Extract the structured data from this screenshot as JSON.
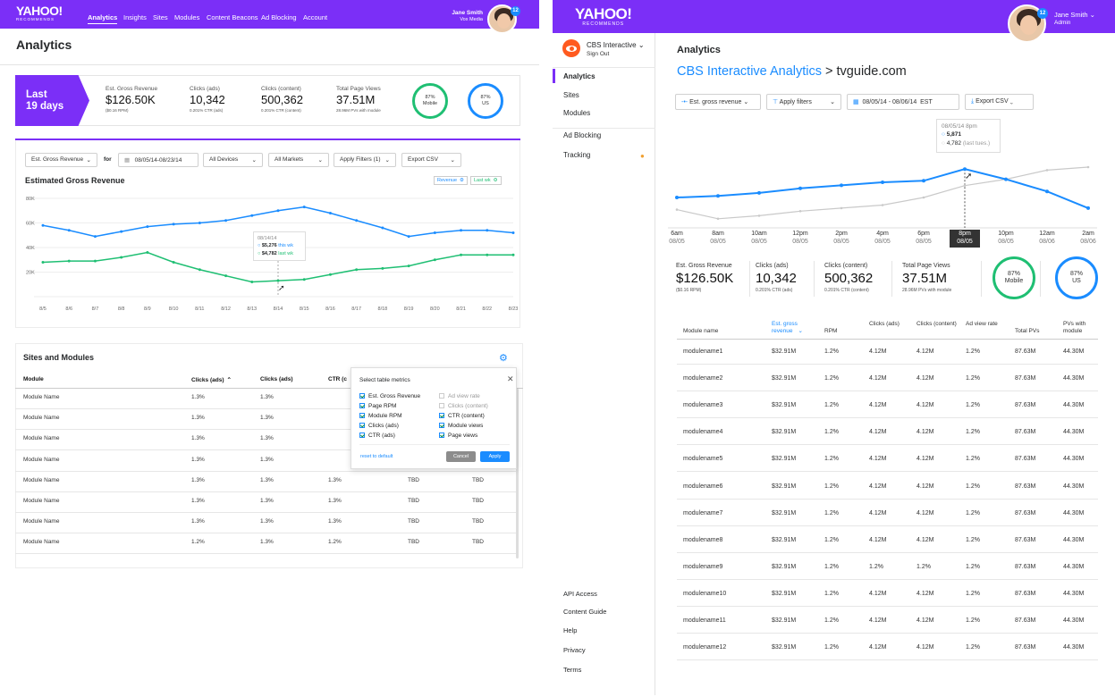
{
  "left": {
    "logo": {
      "name": "YAHOO!",
      "sub": "RECOMMENDS"
    },
    "nav": [
      "Analytics",
      "Insights",
      "Sites",
      "Modules",
      "Content Beacons",
      "Ad Blocking",
      "Account"
    ],
    "user": {
      "name": "Jane Smith",
      "org": "Vox Media",
      "badge": "12"
    },
    "page_title": "Analytics",
    "period": {
      "line1": "Last",
      "line2": "19 days"
    },
    "kpis": [
      {
        "label": "Est. Gross Revenue",
        "value": "$126.50K",
        "sub": "($0.16 RPM)"
      },
      {
        "label": "Clicks (ads)",
        "value": "10,342",
        "sub": "0.201% CTR (ads)"
      },
      {
        "label": "Clicks (content)",
        "value": "500,362",
        "sub": "0.201% CTR (content)"
      },
      {
        "label": "Total Page Views",
        "value": "37.51M",
        "sub": "28.96M PVs with module"
      }
    ],
    "rings": [
      {
        "pct": "87%",
        "label": "Mobile",
        "color": "#1fbf73"
      },
      {
        "pct": "87%",
        "label": "US",
        "color": "#1a8cff"
      }
    ],
    "filters": {
      "metric": "Est. Gross Revenue",
      "for": "for",
      "date": "08/05/14-08/23/14",
      "devices": "All Devices",
      "markets": "All Markets",
      "apply": "Apply Filters (1)",
      "export": "Export CSV"
    },
    "chart_title": "Estimated Gross Revenue",
    "legend": [
      {
        "label": "Revenue",
        "color": "#1a8cff"
      },
      {
        "label": "Last wk",
        "color": "#1fbf73"
      }
    ],
    "tooltip": {
      "date": "08/14/14",
      "v1": "$5,276",
      "l1": "this wk",
      "v2": "$4,782",
      "l2": "last wk"
    },
    "table_title": "Sites and Modules",
    "table_headers": [
      "Module",
      "Clicks (ads)",
      "Clicks (ads)",
      "CTR (c"
    ],
    "rows": [
      [
        "Module Name",
        "1.3%",
        "1.3%",
        "",
        "",
        ""
      ],
      [
        "Module Name",
        "1.3%",
        "1.3%",
        "",
        "",
        ""
      ],
      [
        "Module Name",
        "1.3%",
        "1.3%",
        "",
        "",
        ""
      ],
      [
        "Module Name",
        "1.3%",
        "1.3%",
        "",
        "",
        ""
      ],
      [
        "Module Name",
        "1.3%",
        "1.3%",
        "1.3%",
        "TBD",
        "TBD"
      ],
      [
        "Module Name",
        "1.3%",
        "1.3%",
        "1.3%",
        "TBD",
        "TBD"
      ],
      [
        "Module Name",
        "1.3%",
        "1.3%",
        "1.3%",
        "TBD",
        "TBD"
      ],
      [
        "Module Name",
        "1.2%",
        "1.3%",
        "1.2%",
        "TBD",
        "TBD"
      ]
    ],
    "popup": {
      "title": "Select table metrics",
      "col1": [
        {
          "label": "Est. Gross Revenue",
          "on": true
        },
        {
          "label": "Page RPM",
          "on": true
        },
        {
          "label": "Module RPM",
          "on": true
        },
        {
          "label": "Clicks (ads)",
          "on": true
        },
        {
          "label": "CTR (ads)",
          "on": true
        }
      ],
      "col2": [
        {
          "label": "Ad view rate",
          "on": false
        },
        {
          "label": "Clicks (content)",
          "on": false
        },
        {
          "label": "CTR (content)",
          "on": true
        },
        {
          "label": "Module views",
          "on": true
        },
        {
          "label": "Page views",
          "on": true
        }
      ],
      "reset": "reset to default",
      "cancel": "Cancel",
      "apply": "Apply"
    }
  },
  "chart_data": [
    {
      "type": "line",
      "title": "Estimated Gross Revenue",
      "x": [
        "8/5",
        "8/6",
        "8/7",
        "8/8",
        "8/9",
        "8/10",
        "8/11",
        "8/12",
        "8/13",
        "8/14",
        "8/15",
        "8/16",
        "8/17",
        "8/18",
        "8/19",
        "8/20",
        "8/21",
        "8/22",
        "8/23"
      ],
      "yticks": [
        "80K",
        "60K",
        "40K",
        "20K"
      ],
      "ylim": [
        0,
        80000
      ],
      "series": [
        {
          "name": "Revenue",
          "color": "#1a8cff",
          "values": [
            58000,
            54000,
            49000,
            53000,
            57000,
            59000,
            60000,
            62000,
            66000,
            70000,
            73000,
            68000,
            62000,
            56000,
            49000,
            52000,
            54000,
            54000,
            52000
          ]
        },
        {
          "name": "Last wk",
          "color": "#1fbf73",
          "values": [
            28000,
            29000,
            29000,
            32000,
            36000,
            28000,
            22000,
            17000,
            12000,
            13000,
            14000,
            18000,
            22000,
            23000,
            25000,
            30000,
            34000,
            34000,
            34000
          ]
        }
      ]
    },
    {
      "type": "line",
      "x": [
        "6am 08/05",
        "8am 08/05",
        "10am 08/05",
        "12pm 08/05",
        "2pm 08/05",
        "4pm 08/05",
        "6pm 08/05",
        "8pm 08/05",
        "10pm 08/05",
        "12am 08/06",
        "2am 08/06"
      ],
      "series": [
        {
          "name": "",
          "color": "#1a8cff",
          "values": [
            4000,
            4100,
            4300,
            4600,
            4800,
            5000,
            5100,
            5871,
            5200,
            4400,
            3300
          ]
        },
        {
          "name": "(last tues.)",
          "color": "#c9c9c9",
          "values": [
            3200,
            2600,
            2800,
            3100,
            3300,
            3500,
            4000,
            4782,
            5200,
            5800,
            6000
          ]
        }
      ]
    }
  ],
  "right": {
    "logo": {
      "name": "YAHOO!",
      "sub": "RECOMMENDS"
    },
    "user": {
      "name": "Jane Smith",
      "role": "Admin",
      "badge": "12"
    },
    "account": {
      "name": "CBS Interactive",
      "signout": "Sign Out"
    },
    "side_nav": [
      "Analytics",
      "Sites",
      "Modules",
      "Ad Blocking",
      "Tracking"
    ],
    "side_bottom": [
      "API Access",
      "Content Guide",
      "Help",
      "Privacy",
      "Terms"
    ],
    "page_title": "Analytics",
    "breadcrumb": {
      "link": "CBS Interactive Analytics",
      "sep": ">",
      "current": "tvguide.com"
    },
    "filters": {
      "metric": "Est. gross revenue",
      "apply": "Apply filters",
      "date": "08/05/14 - 08/06/14",
      "tz": "EST",
      "export": "Export CSV"
    },
    "tooltip": {
      "date": "08/05/14 8pm",
      "v1": "5,871",
      "v2": "4,782",
      "l2": "(last tues.)"
    },
    "xticks": [
      [
        "6am",
        "08/05"
      ],
      [
        "8am",
        "08/05"
      ],
      [
        "10am",
        "08/05"
      ],
      [
        "12pm",
        "08/05"
      ],
      [
        "2pm",
        "08/05"
      ],
      [
        "4pm",
        "08/05"
      ],
      [
        "6pm",
        "08/05"
      ],
      [
        "8pm",
        "08/05"
      ],
      [
        "10pm",
        "08/05"
      ],
      [
        "12am",
        "08/06"
      ],
      [
        "2am",
        "08/06"
      ]
    ],
    "kpis": [
      {
        "label": "Est. Gross Revenue",
        "value": "$126.50K",
        "sub": "($0.16 RPM)"
      },
      {
        "label": "Clicks (ads)",
        "value": "10,342",
        "sub": "0.201% CTR (ads)"
      },
      {
        "label": "Clicks (content)",
        "value": "500,362",
        "sub": "0.201% CTR (content)"
      },
      {
        "label": "Total Page Views",
        "value": "37.51M",
        "sub": "28.96M PVs with module"
      }
    ],
    "rings": [
      {
        "pct": "87%",
        "label": "Mobile",
        "color": "#1fbf73"
      },
      {
        "pct": "87%",
        "label": "US",
        "color": "#1a8cff"
      }
    ],
    "table_headers": [
      "Module name",
      "Est. gross revenue",
      "RPM",
      "Clicks (ads)",
      "Clicks (content)",
      "Ad view rate",
      "Total PVs",
      "PVs with module"
    ],
    "rows": [
      [
        "modulename1",
        "$32.91M",
        "1.2%",
        "4.12M",
        "4.12M",
        "1.2%",
        "87.63M",
        "44.30M"
      ],
      [
        "modulename2",
        "$32.91M",
        "1.2%",
        "4.12M",
        "4.12M",
        "1.2%",
        "87.63M",
        "44.30M"
      ],
      [
        "modulename3",
        "$32.91M",
        "1.2%",
        "4.12M",
        "4.12M",
        "1.2%",
        "87.63M",
        "44.30M"
      ],
      [
        "modulename4",
        "$32.91M",
        "1.2%",
        "4.12M",
        "4.12M",
        "1.2%",
        "87.63M",
        "44.30M"
      ],
      [
        "modulename5",
        "$32.91M",
        "1.2%",
        "4.12M",
        "4.12M",
        "1.2%",
        "87.63M",
        "44.30M"
      ],
      [
        "modulename6",
        "$32.91M",
        "1.2%",
        "4.12M",
        "4.12M",
        "1.2%",
        "87.63M",
        "44.30M"
      ],
      [
        "modulename7",
        "$32.91M",
        "1.2%",
        "4.12M",
        "4.12M",
        "1.2%",
        "87.63M",
        "44.30M"
      ],
      [
        "modulename8",
        "$32.91M",
        "1.2%",
        "4.12M",
        "4.12M",
        "1.2%",
        "87.63M",
        "44.30M"
      ],
      [
        "modulename9",
        "$32.91M",
        "1.2%",
        "1.2%",
        "1.2%",
        "1.2%",
        "87.63M",
        "44.30M"
      ],
      [
        "modulename10",
        "$32.91M",
        "1.2%",
        "4.12M",
        "4.12M",
        "1.2%",
        "87.63M",
        "44.30M"
      ],
      [
        "modulename11",
        "$32.91M",
        "1.2%",
        "4.12M",
        "4.12M",
        "1.2%",
        "87.63M",
        "44.30M"
      ],
      [
        "modulename12",
        "$32.91M",
        "1.2%",
        "4.12M",
        "4.12M",
        "1.2%",
        "87.63M",
        "44.30M"
      ]
    ]
  }
}
